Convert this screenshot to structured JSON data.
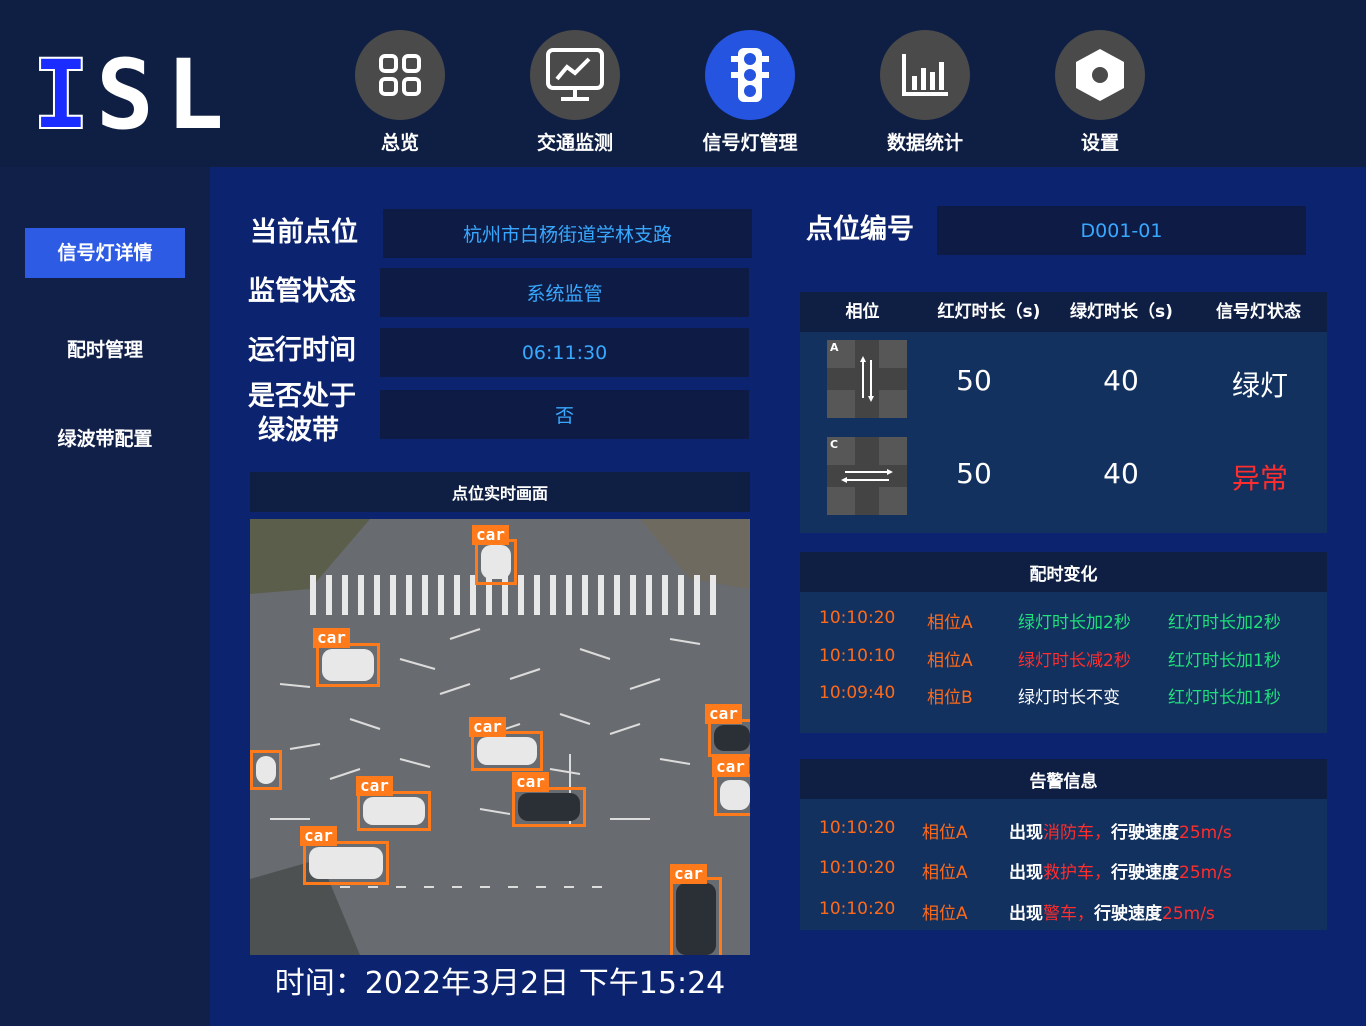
{
  "app": {
    "logo_text": "ISL"
  },
  "nav": {
    "items": [
      {
        "label": "总览",
        "icon": "grid-icon"
      },
      {
        "label": "交通监测",
        "icon": "monitor-chart-icon"
      },
      {
        "label": "信号灯管理",
        "icon": "traffic-light-icon",
        "active": true
      },
      {
        "label": "数据统计",
        "icon": "bar-chart-icon"
      },
      {
        "label": "设置",
        "icon": "hexagon-settings-icon"
      }
    ]
  },
  "sidebar": {
    "items": [
      {
        "label": "信号灯详情",
        "active": true
      },
      {
        "label": "配时管理"
      },
      {
        "label": "绿波带配置"
      }
    ]
  },
  "info": {
    "location_label": "当前点位",
    "location_value": "杭州市白杨街道学林支路",
    "status_label": "监管状态",
    "status_value": "系统监管",
    "runtime_label": "运行时间",
    "runtime_value": "06:11:30",
    "greenwave_label_1": "是否处于",
    "greenwave_label_2": "绿波带",
    "greenwave_value": "否",
    "point_id_label": "点位编号",
    "point_id_value": "D001-01"
  },
  "video": {
    "title": "点位实时画面",
    "detection_label": "car",
    "timestamp": "时间：2022年3月2日 下午15:24"
  },
  "phase_table": {
    "headers": [
      "相位",
      "红灯时长（s)",
      "绿灯时长（s)",
      "信号灯状态"
    ],
    "rows": [
      {
        "phase_letter": "A",
        "red": "50",
        "green": "40",
        "status": "绿灯",
        "status_color": "#ffffff"
      },
      {
        "phase_letter": "C",
        "red": "50",
        "green": "40",
        "status": "异常",
        "status_color": "#ff2d2d"
      }
    ]
  },
  "timing_changes": {
    "title": "配时变化",
    "rows": [
      {
        "time": "10:10:20",
        "phase": "相位A",
        "green_change": "绿灯时长加2秒",
        "green_color": "#1fe07a",
        "red_change": "红灯时长加2秒"
      },
      {
        "time": "10:10:10",
        "phase": "相位A",
        "green_change": "绿灯时长减2秒",
        "green_color": "#ff2d2d",
        "red_change": "红灯时长加1秒"
      },
      {
        "time": "10:09:40",
        "phase": "相位B",
        "green_change": "绿灯时长不变",
        "green_color": "#ffffff",
        "red_change": "红灯时长加1秒"
      }
    ]
  },
  "alerts": {
    "title": "告警信息",
    "rows": [
      {
        "time": "10:10:20",
        "phase": "相位A",
        "prefix": "出现",
        "vehicle": "消防车，",
        "speed_label": "行驶速度",
        "speed": "25m/s"
      },
      {
        "time": "10:10:20",
        "phase": "相位A",
        "prefix": "出现",
        "vehicle": "救护车，",
        "speed_label": "行驶速度",
        "speed": "25m/s"
      },
      {
        "time": "10:10:20",
        "phase": "相位A",
        "prefix": "出现",
        "vehicle": "警车，",
        "speed_label": "行驶速度",
        "speed": "25m/s"
      }
    ]
  },
  "colors": {
    "accent_blue": "#2d5be3",
    "value_blue": "#38a8ff",
    "alert_orange": "#ff6a1a",
    "ok_green": "#1fe07a",
    "error_red": "#ff2d2d"
  }
}
